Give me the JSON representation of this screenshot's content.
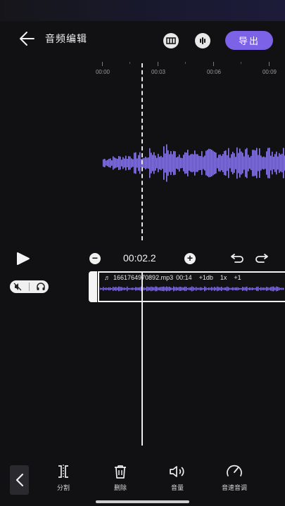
{
  "header": {
    "title": "音频编辑",
    "export_label": "导出",
    "icons": [
      "back-arrow-icon",
      "frames-icon",
      "waveform-icon"
    ]
  },
  "ruler": {
    "labels": [
      "00:00",
      "00:03",
      "00:06",
      "00:09"
    ]
  },
  "playback": {
    "current_time": "00:02.2",
    "icons": [
      "play-icon",
      "zoom-out-icon",
      "zoom-in-icon",
      "undo-icon",
      "redo-icon"
    ]
  },
  "toggles": {
    "icons": [
      "mute-icon",
      "headphones-icon"
    ]
  },
  "track": {
    "filename": "1661764970892.mp3",
    "duration": "00:14",
    "volume": "+1db",
    "speed": "1x",
    "pitch": "+1",
    "icon": "music-note-icon"
  },
  "toolbar": {
    "items": [
      {
        "label": "分割",
        "icon": "split-icon"
      },
      {
        "label": "删除",
        "icon": "trash-icon"
      },
      {
        "label": "音量",
        "icon": "volume-icon"
      },
      {
        "label": "音速音调",
        "icon": "speedometer-icon"
      }
    ],
    "back_icon": "chevron-left-icon"
  },
  "colors": {
    "accent": "#7b62e6",
    "waveform": "#8b7be8",
    "background": "#111113"
  }
}
